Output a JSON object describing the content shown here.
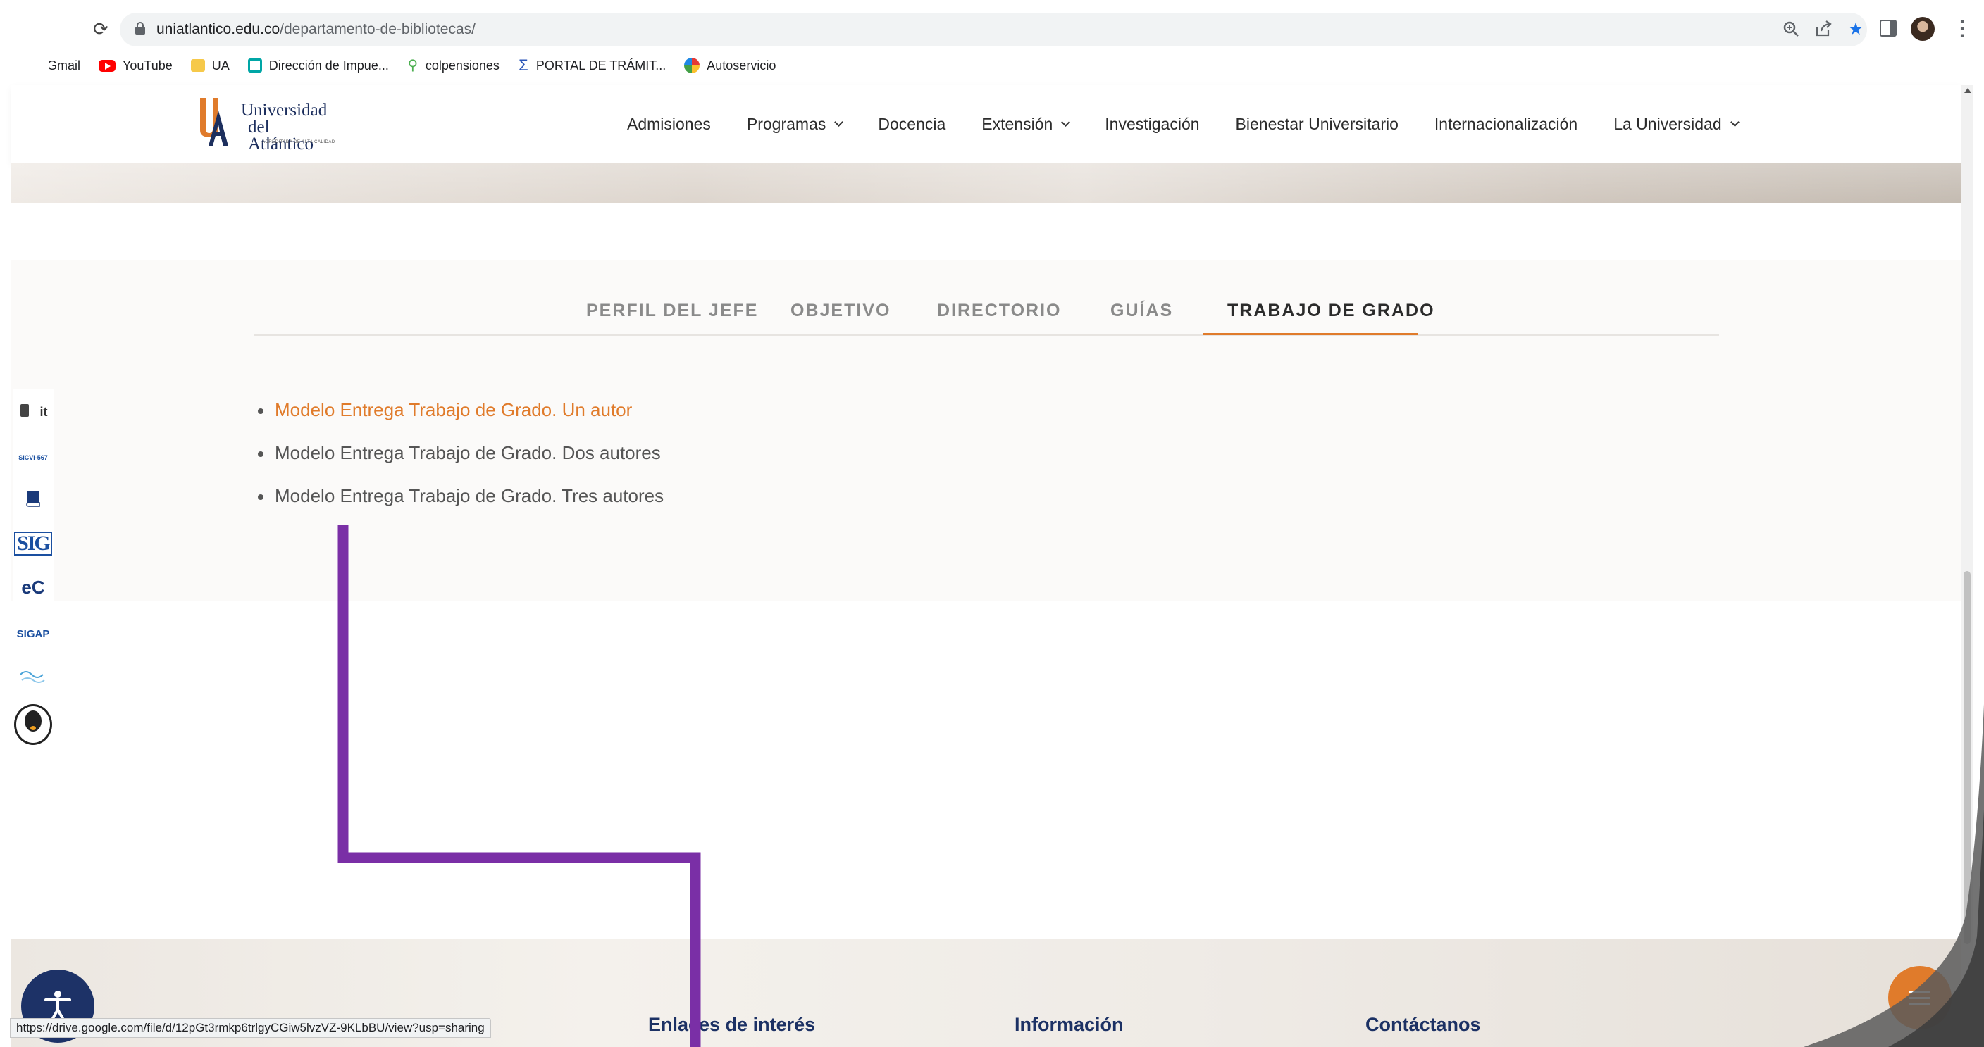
{
  "browser": {
    "url_host": "uniatlantico.edu.co",
    "url_path": "/departamento-de-bibliotecas/",
    "bookmarks": [
      {
        "label": "Gmail",
        "icon": "gmail-icon"
      },
      {
        "label": "YouTube",
        "icon": "youtube-icon"
      },
      {
        "label": "UA",
        "icon": "folder-icon"
      },
      {
        "label": "Dirección de Impue...",
        "icon": "dian-icon"
      },
      {
        "label": "colpensiones",
        "icon": "colpensiones-icon"
      },
      {
        "label": "PORTAL DE TRÁMIT...",
        "icon": "sigma-icon"
      },
      {
        "label": "Autoservicio",
        "icon": "autoservicio-icon"
      }
    ],
    "status_url": "https://drive.google.com/file/d/12pGt3rmkp6trlgyCGiw5lvzVZ-9KLbBU/view?usp=sharing"
  },
  "header": {
    "logo_line1": "Universidad",
    "logo_line2": "del Atlántico",
    "logo_tagline": "ACREDITADA DE ALTA CALIDAD",
    "nav": [
      {
        "label": "Admisiones",
        "dropdown": false
      },
      {
        "label": "Programas",
        "dropdown": true
      },
      {
        "label": "Docencia",
        "dropdown": false
      },
      {
        "label": "Extensión",
        "dropdown": true
      },
      {
        "label": "Investigación",
        "dropdown": false
      },
      {
        "label": "Bienestar Universitario",
        "dropdown": false
      },
      {
        "label": "Internacionalización",
        "dropdown": false
      },
      {
        "label": "La Universidad",
        "dropdown": true
      }
    ]
  },
  "tabs": [
    {
      "label": "PERFIL DEL JEFE",
      "active": false
    },
    {
      "label": "OBJETIVO",
      "active": false
    },
    {
      "label": "DIRECTORIO",
      "active": false
    },
    {
      "label": "GUÍAS",
      "active": false
    },
    {
      "label": "TRABAJO DE GRADO",
      "active": true
    }
  ],
  "documents": [
    {
      "label": "Modelo Entrega Trabajo de Grado. Un autor",
      "hovered": true
    },
    {
      "label": "Modelo Entrega Trabajo de Grado. Dos autores",
      "hovered": false
    },
    {
      "label": "Modelo Entrega Trabajo de Grado. Tres autores",
      "hovered": false
    }
  ],
  "side_icons": [
    {
      "label": "it",
      "icon": "moodle-icon"
    },
    {
      "label": "SICVI-567",
      "icon": "sicvi-icon"
    },
    {
      "label": "",
      "icon": "book-icon"
    },
    {
      "label": "SIG",
      "icon": "sig-icon"
    },
    {
      "label": "eC",
      "icon": "econtinua-icon"
    },
    {
      "label": "SIGAP",
      "icon": "sigap-icon"
    },
    {
      "label": "",
      "icon": "wave-icon"
    },
    {
      "label": "",
      "icon": "penguin-icon"
    }
  ],
  "footer": {
    "col1": "Enlaces de interés",
    "col2": "Información",
    "col3": "Contáctanos"
  },
  "colors": {
    "accent": "#e07b2b",
    "navy": "#1c3164",
    "annotation": "#7a2fa6"
  }
}
